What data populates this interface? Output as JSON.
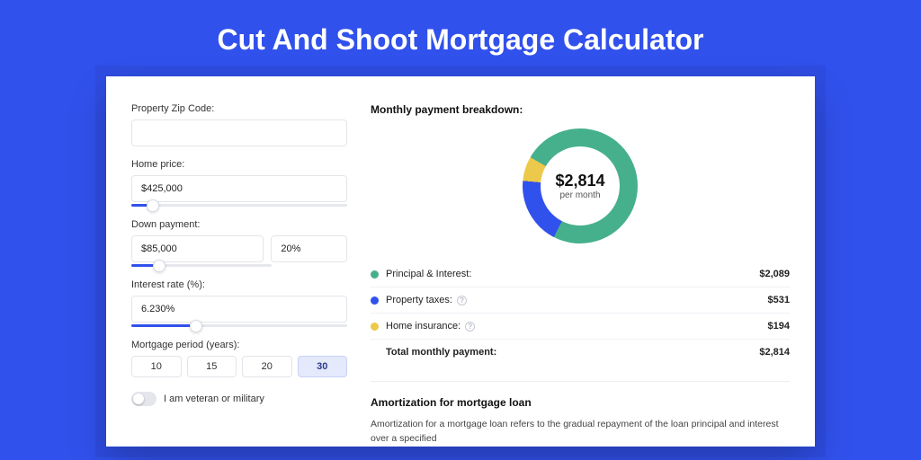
{
  "title": "Cut And Shoot Mortgage Calculator",
  "form": {
    "zip_label": "Property Zip Code:",
    "zip_value": "",
    "price_label": "Home price:",
    "price_value": "$425,000",
    "price_slider_pct": 10,
    "dp_label": "Down payment:",
    "dp_value": "$85,000",
    "dp_pct_value": "20%",
    "dp_slider_pct": 20,
    "rate_label": "Interest rate (%):",
    "rate_value": "6.230%",
    "rate_slider_pct": 30,
    "period_label": "Mortgage period (years):",
    "periods": [
      "10",
      "15",
      "20",
      "30"
    ],
    "period_active": "30",
    "veteran_label": "I am veteran or military"
  },
  "breakdown": {
    "title": "Monthly payment breakdown:",
    "donut_amount": "$2,814",
    "donut_sub": "per month",
    "items": [
      {
        "label": "Principal & Interest:",
        "value": "$2,089",
        "color": "#46b08c",
        "info": false
      },
      {
        "label": "Property taxes:",
        "value": "$531",
        "color": "#3151ec",
        "info": true
      },
      {
        "label": "Home insurance:",
        "value": "$194",
        "color": "#ecc94b",
        "info": true
      }
    ],
    "total_label": "Total monthly payment:",
    "total_value": "$2,814"
  },
  "chart_data": {
    "type": "pie",
    "title": "$2,814 per month",
    "series": [
      {
        "name": "Principal & Interest",
        "value": 2089,
        "color": "#46b08c"
      },
      {
        "name": "Property taxes",
        "value": 531,
        "color": "#3151ec"
      },
      {
        "name": "Home insurance",
        "value": 194,
        "color": "#ecc94b"
      }
    ],
    "total": 2814
  },
  "amort": {
    "title": "Amortization for mortgage loan",
    "text": "Amortization for a mortgage loan refers to the gradual repayment of the loan principal and interest over a specified"
  }
}
